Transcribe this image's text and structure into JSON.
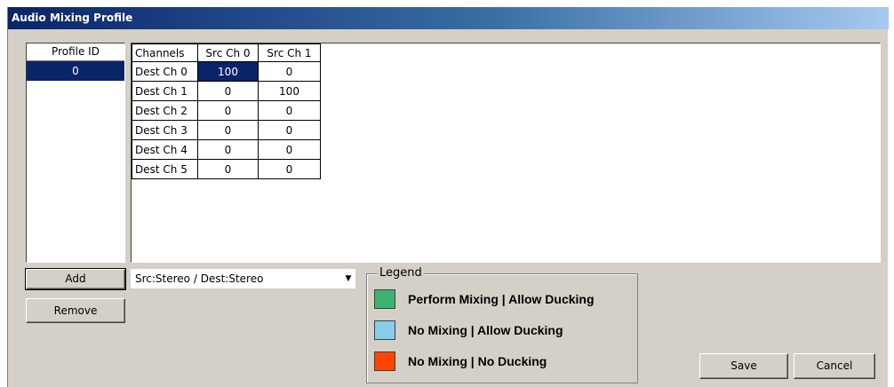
{
  "window": {
    "title": "Audio Mixing Profile"
  },
  "profiles": {
    "header": "Profile ID",
    "items": [
      "0"
    ]
  },
  "matrix": {
    "headers": [
      "Channels",
      "Src Ch 0",
      "Src Ch 1"
    ],
    "rows": [
      {
        "label": "Dest Ch 0",
        "values": [
          "100",
          "0"
        ]
      },
      {
        "label": "Dest Ch 1",
        "values": [
          "0",
          "100"
        ]
      },
      {
        "label": "Dest Ch 2",
        "values": [
          "0",
          "0"
        ]
      },
      {
        "label": "Dest Ch 3",
        "values": [
          "0",
          "0"
        ]
      },
      {
        "label": "Dest Ch 4",
        "values": [
          "0",
          "0"
        ]
      },
      {
        "label": "Dest Ch 5",
        "values": [
          "0",
          "0"
        ]
      }
    ]
  },
  "buttons": {
    "add": "Add",
    "remove": "Remove",
    "save": "Save",
    "cancel": "Cancel"
  },
  "mapping_select": {
    "value": "Src:Stereo / Dest:Stereo"
  },
  "legend": {
    "title": "Legend",
    "items": [
      {
        "label": "Perform Mixing | Allow Ducking",
        "color": "#3cb371"
      },
      {
        "label": "No Mixing | Allow Ducking",
        "color": "#87ceeb"
      },
      {
        "label": "No Mixing | No Ducking",
        "color": "#ff4500"
      }
    ]
  }
}
